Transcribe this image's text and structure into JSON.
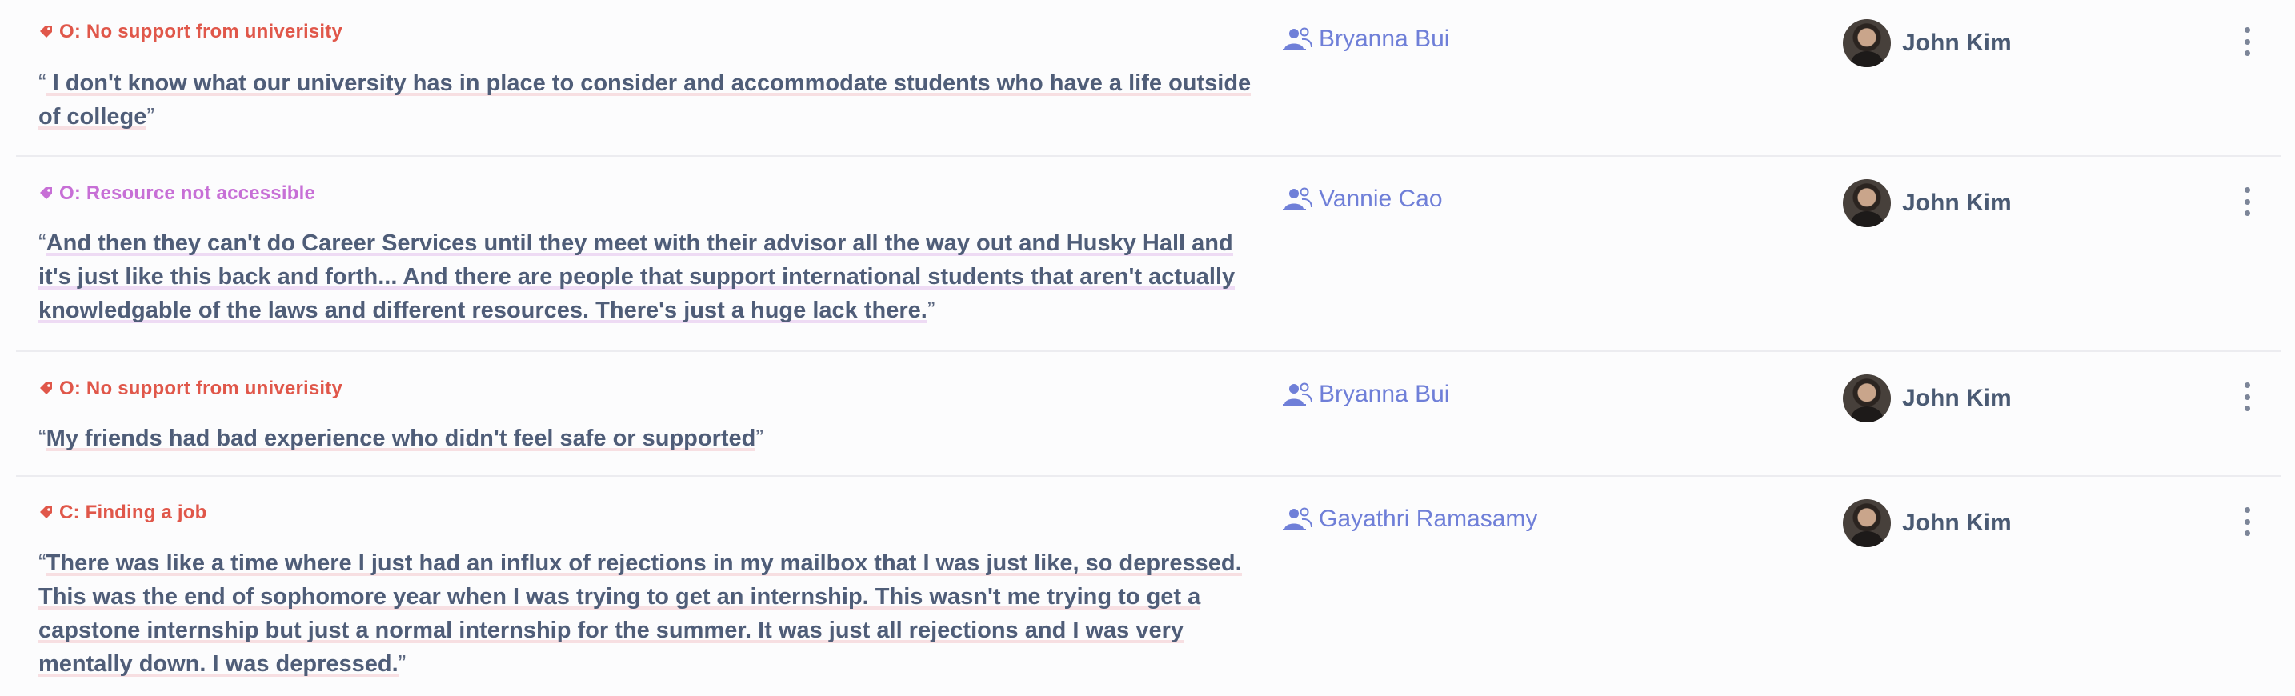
{
  "colors": {
    "tag_red": "#e0574a",
    "tag_purple": "#c76fd6",
    "person_blue": "#6f7fd8",
    "text": "#4f5d78"
  },
  "rows": [
    {
      "tag": {
        "label": "O: No support from univerisity",
        "color": "#e0574a",
        "icon": "tag-icon"
      },
      "quote": {
        "open": "“",
        "text": " I don't know what our university has in place to consider and accommodate students who have a life outside of college",
        "close": "”"
      },
      "participant": {
        "name": "Bryanna Bui",
        "icon": "people-icon"
      },
      "owner": {
        "name": "John Kim",
        "icon": "avatar"
      },
      "menu_icon": "more-vertical-icon"
    },
    {
      "tag": {
        "label": "O: Resource not accessible",
        "color": "#c76fd6",
        "icon": "tag-icon"
      },
      "quote": {
        "open": "“",
        "text": "And then they can't do Career Services until they meet with their advisor all the way out and Husky Hall and it's just like this back and forth... And there are people that support international students that aren't actually knowledgable of the laws and different resources. There's just a huge lack there.",
        "close": "”"
      },
      "participant": {
        "name": "Vannie Cao",
        "icon": "people-icon"
      },
      "owner": {
        "name": "John Kim",
        "icon": "avatar"
      },
      "menu_icon": "more-vertical-icon"
    },
    {
      "tag": {
        "label": "O: No support from univerisity",
        "color": "#e0574a",
        "icon": "tag-icon"
      },
      "quote": {
        "open": "“",
        "text": "My friends had bad experience who didn't feel safe or supported",
        "close": "”"
      },
      "participant": {
        "name": "Bryanna Bui",
        "icon": "people-icon"
      },
      "owner": {
        "name": "John Kim",
        "icon": "avatar"
      },
      "menu_icon": "more-vertical-icon"
    },
    {
      "tag": {
        "label": "C: Finding a job",
        "color": "#e0574a",
        "icon": "tag-icon"
      },
      "quote": {
        "open": "“",
        "text": "There was like a time where I just had an influx of rejections in my mailbox that I was just like, so depressed. This was the end of sophomore year when I was trying to get an internship. This wasn't me trying to get a capstone internship but just a normal internship for the summer. It was just all rejections and I was very mentally down. I was depressed.",
        "close": "”"
      },
      "participant": {
        "name": "Gayathri Ramasamy",
        "icon": "people-icon"
      },
      "owner": {
        "name": "John Kim",
        "icon": "avatar"
      },
      "menu_icon": "more-vertical-icon"
    }
  ]
}
